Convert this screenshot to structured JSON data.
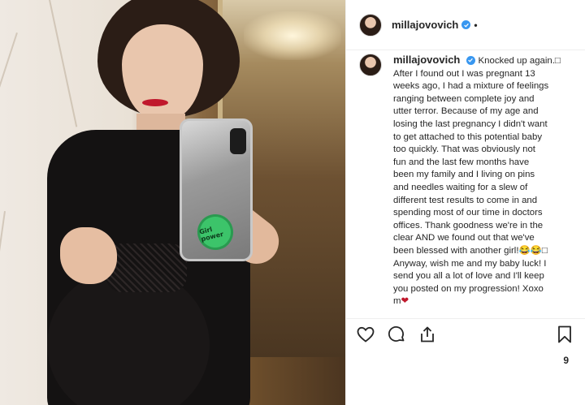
{
  "header": {
    "username": "millajovovich",
    "verified_icon": "verified-badge-icon",
    "separator": "•"
  },
  "photo": {
    "popsocket_text": "Girl power"
  },
  "caption": {
    "username": "millajovovich",
    "text_lines": [
      "Knocked up again.□",
      "After I found out I was pregnant 13",
      "weeks ago, I had a mixture of feelings",
      "ranging between complete joy and",
      "utter terror. Because of my age and",
      "losing the last pregnancy I didn't want",
      "to get attached to this potential baby",
      "too quickly. That was obviously not",
      "fun and the last few months have",
      "been my family and I living on pins",
      "and needles waiting for a slew of",
      "different test results to come in and",
      "spending most of our time in doctors",
      "offices. Thank goodness we're in the",
      "clear AND we found out that we've",
      "been blessed with another girl!😂😂□",
      "Anyway, wish me and my baby luck! I",
      "send you all a lot of love and I'll keep",
      "you posted on my progression! Xoxo",
      "m"
    ],
    "heart": "❤"
  },
  "actions": {
    "like_icon": "heart-icon",
    "comment_icon": "comment-icon",
    "share_icon": "share-icon",
    "save_icon": "bookmark-icon"
  },
  "likes_count": "9",
  "colors": {
    "verified": "#3897f0",
    "text": "#262626",
    "border": "#efefef",
    "heart": "#c0182c"
  }
}
